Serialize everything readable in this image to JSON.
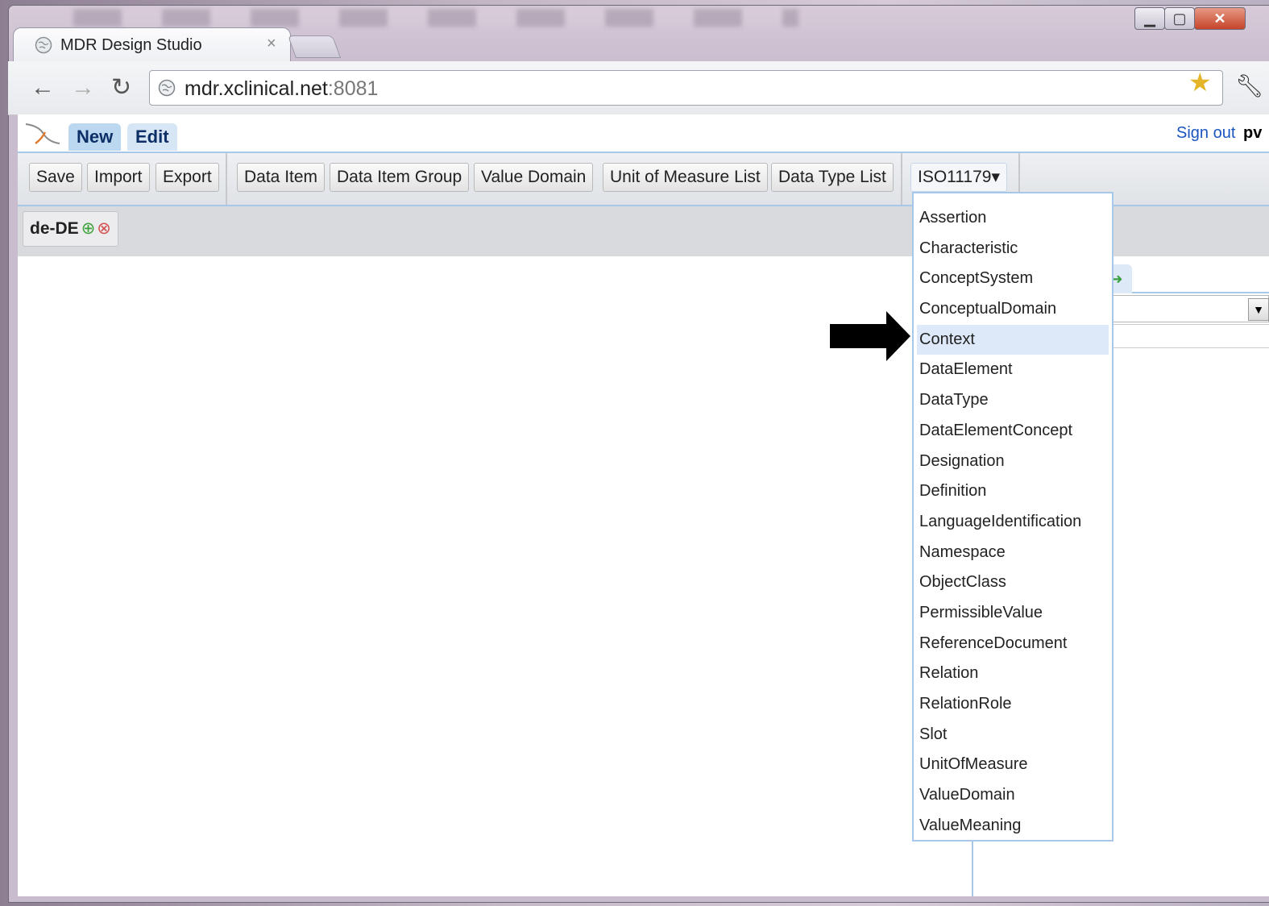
{
  "browser": {
    "tab_title": "MDR Design Studio",
    "tab_close": "×",
    "url_host": "mdr.xclinical.net",
    "url_port": ":8081",
    "window_controls": [
      "minimize",
      "maximize",
      "close"
    ]
  },
  "app": {
    "tabs": [
      "New",
      "Edit"
    ],
    "sign_out": "Sign out",
    "user": "pv"
  },
  "toolbar": {
    "save": "Save",
    "import": "Import",
    "export": "Export",
    "data_item": "Data Item",
    "data_item_group": "Data Item Group",
    "value_domain": "Value Domain",
    "unit_of_measure_list": "Unit of Measure List",
    "data_type_list": "Data Type List",
    "iso_menu": "ISO11179▾"
  },
  "language": {
    "code": "de-DE",
    "add": "⊕",
    "remove": "⊗"
  },
  "iso_menu_items": [
    "Assertion",
    "Characteristic",
    "ConceptSystem",
    "ConceptualDomain",
    "Context",
    "DataElement",
    "DataType",
    "DataElementConcept",
    "Designation",
    "Definition",
    "LanguageIdentification",
    "Namespace",
    "ObjectClass",
    "PermissibleValue",
    "ReferenceDocument",
    "Relation",
    "RelationRole",
    "Slot",
    "UnitOfMeasure",
    "ValueDomain",
    "ValueMeaning"
  ],
  "iso_menu_highlighted": "Context",
  "colors": {
    "accent_border": "#a8c8ea",
    "tab_active": "#bcd7f0",
    "link": "#1a55c0",
    "highlight": "#dde9f8"
  }
}
